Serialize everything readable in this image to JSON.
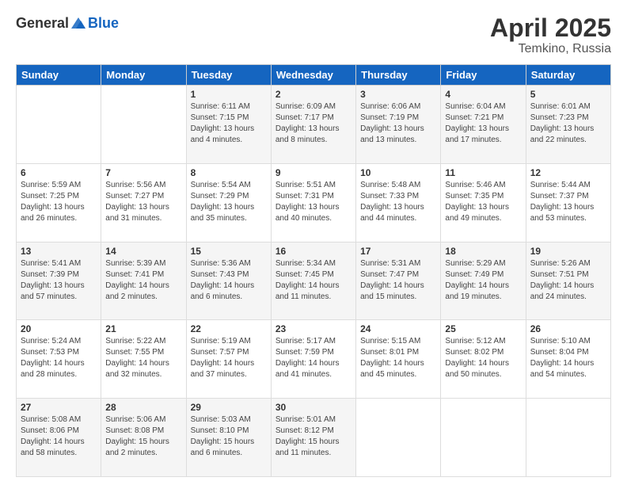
{
  "header": {
    "logo_general": "General",
    "logo_blue": "Blue",
    "title": "April 2025",
    "location": "Temkino, Russia"
  },
  "weekdays": [
    "Sunday",
    "Monday",
    "Tuesday",
    "Wednesday",
    "Thursday",
    "Friday",
    "Saturday"
  ],
  "weeks": [
    [
      {
        "day": "",
        "info": ""
      },
      {
        "day": "",
        "info": ""
      },
      {
        "day": "1",
        "info": "Sunrise: 6:11 AM\nSunset: 7:15 PM\nDaylight: 13 hours and 4 minutes."
      },
      {
        "day": "2",
        "info": "Sunrise: 6:09 AM\nSunset: 7:17 PM\nDaylight: 13 hours and 8 minutes."
      },
      {
        "day": "3",
        "info": "Sunrise: 6:06 AM\nSunset: 7:19 PM\nDaylight: 13 hours and 13 minutes."
      },
      {
        "day": "4",
        "info": "Sunrise: 6:04 AM\nSunset: 7:21 PM\nDaylight: 13 hours and 17 minutes."
      },
      {
        "day": "5",
        "info": "Sunrise: 6:01 AM\nSunset: 7:23 PM\nDaylight: 13 hours and 22 minutes."
      }
    ],
    [
      {
        "day": "6",
        "info": "Sunrise: 5:59 AM\nSunset: 7:25 PM\nDaylight: 13 hours and 26 minutes."
      },
      {
        "day": "7",
        "info": "Sunrise: 5:56 AM\nSunset: 7:27 PM\nDaylight: 13 hours and 31 minutes."
      },
      {
        "day": "8",
        "info": "Sunrise: 5:54 AM\nSunset: 7:29 PM\nDaylight: 13 hours and 35 minutes."
      },
      {
        "day": "9",
        "info": "Sunrise: 5:51 AM\nSunset: 7:31 PM\nDaylight: 13 hours and 40 minutes."
      },
      {
        "day": "10",
        "info": "Sunrise: 5:48 AM\nSunset: 7:33 PM\nDaylight: 13 hours and 44 minutes."
      },
      {
        "day": "11",
        "info": "Sunrise: 5:46 AM\nSunset: 7:35 PM\nDaylight: 13 hours and 49 minutes."
      },
      {
        "day": "12",
        "info": "Sunrise: 5:44 AM\nSunset: 7:37 PM\nDaylight: 13 hours and 53 minutes."
      }
    ],
    [
      {
        "day": "13",
        "info": "Sunrise: 5:41 AM\nSunset: 7:39 PM\nDaylight: 13 hours and 57 minutes."
      },
      {
        "day": "14",
        "info": "Sunrise: 5:39 AM\nSunset: 7:41 PM\nDaylight: 14 hours and 2 minutes."
      },
      {
        "day": "15",
        "info": "Sunrise: 5:36 AM\nSunset: 7:43 PM\nDaylight: 14 hours and 6 minutes."
      },
      {
        "day": "16",
        "info": "Sunrise: 5:34 AM\nSunset: 7:45 PM\nDaylight: 14 hours and 11 minutes."
      },
      {
        "day": "17",
        "info": "Sunrise: 5:31 AM\nSunset: 7:47 PM\nDaylight: 14 hours and 15 minutes."
      },
      {
        "day": "18",
        "info": "Sunrise: 5:29 AM\nSunset: 7:49 PM\nDaylight: 14 hours and 19 minutes."
      },
      {
        "day": "19",
        "info": "Sunrise: 5:26 AM\nSunset: 7:51 PM\nDaylight: 14 hours and 24 minutes."
      }
    ],
    [
      {
        "day": "20",
        "info": "Sunrise: 5:24 AM\nSunset: 7:53 PM\nDaylight: 14 hours and 28 minutes."
      },
      {
        "day": "21",
        "info": "Sunrise: 5:22 AM\nSunset: 7:55 PM\nDaylight: 14 hours and 32 minutes."
      },
      {
        "day": "22",
        "info": "Sunrise: 5:19 AM\nSunset: 7:57 PM\nDaylight: 14 hours and 37 minutes."
      },
      {
        "day": "23",
        "info": "Sunrise: 5:17 AM\nSunset: 7:59 PM\nDaylight: 14 hours and 41 minutes."
      },
      {
        "day": "24",
        "info": "Sunrise: 5:15 AM\nSunset: 8:01 PM\nDaylight: 14 hours and 45 minutes."
      },
      {
        "day": "25",
        "info": "Sunrise: 5:12 AM\nSunset: 8:02 PM\nDaylight: 14 hours and 50 minutes."
      },
      {
        "day": "26",
        "info": "Sunrise: 5:10 AM\nSunset: 8:04 PM\nDaylight: 14 hours and 54 minutes."
      }
    ],
    [
      {
        "day": "27",
        "info": "Sunrise: 5:08 AM\nSunset: 8:06 PM\nDaylight: 14 hours and 58 minutes."
      },
      {
        "day": "28",
        "info": "Sunrise: 5:06 AM\nSunset: 8:08 PM\nDaylight: 15 hours and 2 minutes."
      },
      {
        "day": "29",
        "info": "Sunrise: 5:03 AM\nSunset: 8:10 PM\nDaylight: 15 hours and 6 minutes."
      },
      {
        "day": "30",
        "info": "Sunrise: 5:01 AM\nSunset: 8:12 PM\nDaylight: 15 hours and 11 minutes."
      },
      {
        "day": "",
        "info": ""
      },
      {
        "day": "",
        "info": ""
      },
      {
        "day": "",
        "info": ""
      }
    ]
  ]
}
